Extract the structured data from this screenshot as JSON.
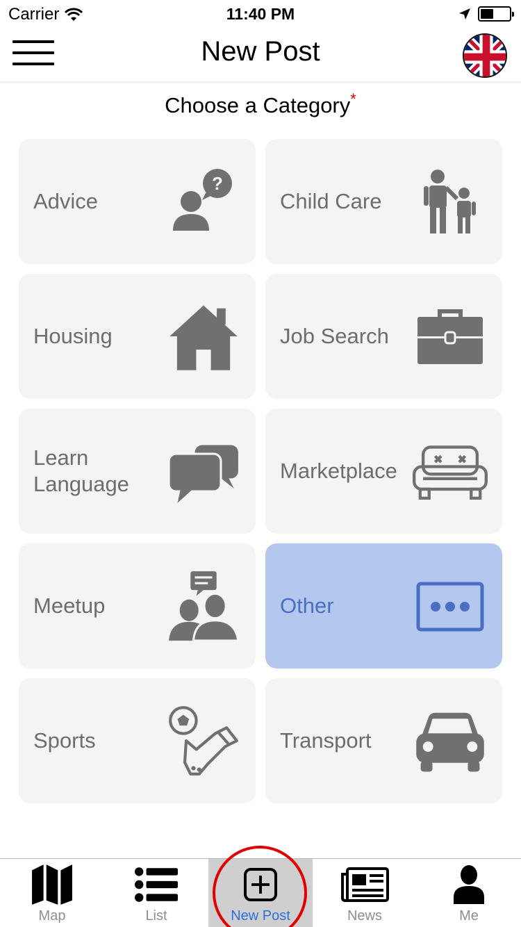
{
  "status_bar": {
    "carrier": "Carrier",
    "time": "11:40 PM"
  },
  "nav": {
    "title": "New Post",
    "language_flag": "uk-flag-icon"
  },
  "heading": {
    "text": "Choose a Category",
    "required_mark": "*"
  },
  "categories": [
    {
      "label": "Advice",
      "icon": "advice-icon",
      "selected": false
    },
    {
      "label": "Child Care",
      "icon": "child-care-icon",
      "selected": false
    },
    {
      "label": "Housing",
      "icon": "house-icon",
      "selected": false
    },
    {
      "label": "Job Search",
      "icon": "briefcase-icon",
      "selected": false
    },
    {
      "label": "Learn\nLanguage",
      "icon": "chat-bubbles-icon",
      "selected": false
    },
    {
      "label": "Marketplace",
      "icon": "sofa-icon",
      "selected": false
    },
    {
      "label": "Meetup",
      "icon": "meetup-icon",
      "selected": false
    },
    {
      "label": "Other",
      "icon": "more-icon",
      "selected": true
    },
    {
      "label": "Sports",
      "icon": "sports-icon",
      "selected": false
    },
    {
      "label": "Transport",
      "icon": "car-icon",
      "selected": false
    }
  ],
  "tabs": [
    {
      "label": "Map",
      "icon": "map-icon",
      "active": false
    },
    {
      "label": "List",
      "icon": "list-icon",
      "active": false
    },
    {
      "label": "New Post",
      "icon": "add-post-icon",
      "active": true
    },
    {
      "label": "News",
      "icon": "newspaper-icon",
      "active": false
    },
    {
      "label": "Me",
      "icon": "person-icon",
      "active": false
    }
  ],
  "colors": {
    "tile_bg": "#f4f4f4",
    "tile_selected_bg": "#b4c7ee",
    "tile_selected_text": "#4a6fc0",
    "tab_active_label": "#2f6fdb",
    "highlight_ring": "#e00000"
  }
}
